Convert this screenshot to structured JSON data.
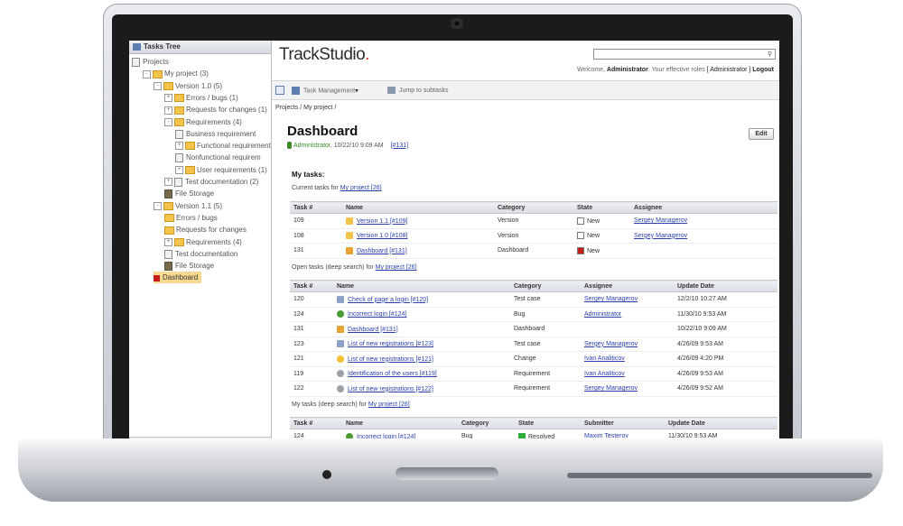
{
  "sidebar": {
    "title": "Tasks Tree",
    "nodes": [
      {
        "label": "Projects",
        "depth": 0,
        "icon": "doc-icon",
        "toggle": ""
      },
      {
        "label": "My project (3)",
        "depth": 1,
        "icon": "folder-icon",
        "toggle": "-"
      },
      {
        "label": "Version 1.0 (5)",
        "depth": 2,
        "icon": "folder-icon",
        "toggle": "-"
      },
      {
        "label": "Errors / bugs (1)",
        "depth": 3,
        "icon": "folder-icon",
        "toggle": "+"
      },
      {
        "label": "Requests for changes (1)",
        "depth": 3,
        "icon": "folder-icon",
        "toggle": "+"
      },
      {
        "label": "Requirements (4)",
        "depth": 3,
        "icon": "folder-icon",
        "toggle": "-"
      },
      {
        "label": "Business requirement",
        "depth": 4,
        "icon": "doc-icon",
        "toggle": ""
      },
      {
        "label": "Functional requirement",
        "depth": 4,
        "icon": "folder-icon",
        "toggle": "+"
      },
      {
        "label": "Nonfunctional requirem",
        "depth": 4,
        "icon": "doc-icon",
        "toggle": ""
      },
      {
        "label": "User requirements (1)",
        "depth": 4,
        "icon": "folder-icon",
        "toggle": "+"
      },
      {
        "label": "Test documentation (2)",
        "depth": 3,
        "icon": "doc-icon",
        "toggle": "+"
      },
      {
        "label": "File Storage",
        "depth": 3,
        "icon": "storage-icon",
        "toggle": ""
      },
      {
        "label": "Version 1.1 (5)",
        "depth": 2,
        "icon": "folder-icon",
        "toggle": "-"
      },
      {
        "label": "Errors / bugs",
        "depth": 3,
        "icon": "folder-icon",
        "toggle": ""
      },
      {
        "label": "Requests for changes",
        "depth": 3,
        "icon": "folder-icon",
        "toggle": ""
      },
      {
        "label": "Requirements (4)",
        "depth": 3,
        "icon": "folder-icon",
        "toggle": "+"
      },
      {
        "label": "Test documentation",
        "depth": 3,
        "icon": "doc-icon",
        "toggle": ""
      },
      {
        "label": "File Storage",
        "depth": 3,
        "icon": "storage-icon",
        "toggle": ""
      },
      {
        "label": "Dashboard",
        "depth": 2,
        "icon": "dashboard-icon",
        "toggle": "",
        "selected": true
      }
    ]
  },
  "header": {
    "logo_text": "TrackStudio",
    "logo_dot": ".",
    "welcome_prefix": "Welcome,",
    "user": "Administrator",
    "roles_text": ". Your effective roles",
    "role": "[ Administrator ]",
    "logout": "Logout"
  },
  "toolbar": {
    "task_management": "Task Management",
    "jump": "Jump to subtasks"
  },
  "breadcrumb": "Projects / My project /",
  "page": {
    "title": "Dashboard",
    "edit": "Edit",
    "author": "Administrator",
    "date": "10/22/10 9:09 AM",
    "task_id": "[#131]"
  },
  "my_tasks": {
    "heading": "My tasks:",
    "current_prefix": "Current tasks for",
    "current_link": "My project [26]",
    "current_headers": [
      "Task #",
      "Name",
      "Category",
      "State",
      "Assignee"
    ],
    "current_rows": [
      {
        "task": "109",
        "name": "Version 1.1 [#109]",
        "icon": "folder",
        "category": "Version",
        "state": "New",
        "state_color": "#ffffff",
        "assignee": "Sergey Managerov"
      },
      {
        "task": "108",
        "name": "Version 1.0 [#108]",
        "icon": "folder",
        "category": "Version",
        "state": "New",
        "state_color": "#ffffff",
        "assignee": "Sergey Managerov"
      },
      {
        "task": "131",
        "name": "Dashboard [#131]",
        "icon": "dashboard",
        "category": "Dashboard",
        "state": "New",
        "state_color": "#c81c1c",
        "assignee": ""
      }
    ],
    "open_prefix": "Open tasks (deep search) for",
    "open_link": "My project [26]",
    "open_headers": [
      "Task #",
      "Name",
      "Category",
      "Assignee",
      "Update Date"
    ],
    "open_rows": [
      {
        "task": "120",
        "name": "Check of page a login [#120]",
        "icon": "test",
        "category": "Test case",
        "assignee": "Sergey Managerov",
        "date": "12/2/10 10:27 AM"
      },
      {
        "task": "124",
        "name": "Incorrect login [#124]",
        "icon": "bug",
        "category": "Bug",
        "assignee": "Administrator",
        "date": "11/30/10 9:53 AM"
      },
      {
        "task": "131",
        "name": "Dashboard [#131]",
        "icon": "dashboard",
        "category": "Dashboard",
        "assignee": "",
        "date": "10/22/10 9:09 AM"
      },
      {
        "task": "123",
        "name": "List of new registrations [#123]",
        "icon": "test",
        "category": "Test case",
        "assignee": "Sergey Managerov",
        "date": "4/26/09 9:53 AM"
      },
      {
        "task": "121",
        "name": "List of new registrations [#121]",
        "icon": "change",
        "category": "Change",
        "assignee": "Ivan Analiticov",
        "date": "4/26/09 4:20 PM"
      },
      {
        "task": "119",
        "name": "Identification of the users [#119]",
        "icon": "requirement",
        "category": "Requirement",
        "assignee": "Ivan Analiticov",
        "date": "4/26/09 9:53 AM"
      },
      {
        "task": "122",
        "name": "List of new registrations [#122]",
        "icon": "requirement",
        "category": "Requirement",
        "assignee": "Sergey Managerov",
        "date": "4/26/09 9:52 AM"
      }
    ],
    "mine_prefix": "My tasks (deep search) for",
    "mine_link": "My project [26]",
    "mine_headers": [
      "Task #",
      "Name",
      "Category",
      "State",
      "Submitter",
      "Update Date"
    ],
    "mine_rows": [
      {
        "task": "124",
        "name": "Incorrect login [#124]",
        "icon": "bug",
        "category": "Bug",
        "state": "Resolved",
        "state_color": "#2fae3a",
        "submitter": "Maxim Testerov",
        "date": "11/30/10 9:53 AM"
      }
    ]
  },
  "colors": {
    "folder": "#f3c34c",
    "dashboard": "#e6a334",
    "test": "#8ea2c8",
    "bug": "#4a9a35",
    "change": "#f1c232",
    "requirement": "#9aa0a8",
    "link": "#2a3fa8"
  }
}
